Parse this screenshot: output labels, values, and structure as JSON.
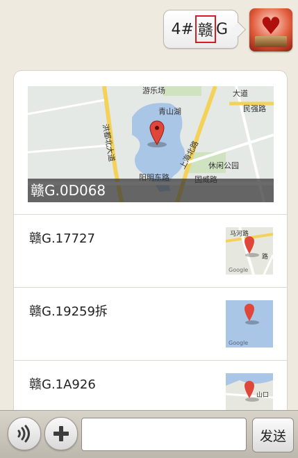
{
  "chat": {
    "message_prefix": "4#",
    "message_highlight": "赣",
    "message_suffix": "G"
  },
  "map_card": {
    "hero": {
      "caption": "赣G.0D068",
      "map_labels": [
        "游乐场",
        "青山湖",
        "大道",
        "民强路",
        "洪都北大道",
        "上海北路",
        "休闲公园",
        "阳明东路",
        "国威路"
      ]
    },
    "items": [
      {
        "label": "赣G.17727",
        "thumb_labels": [
          "马河路",
          "路",
          "Google"
        ]
      },
      {
        "label": "赣G.19259拆",
        "thumb_labels": [
          "Google"
        ]
      },
      {
        "label": "赣G.1A926",
        "thumb_labels": [
          "山口"
        ]
      }
    ]
  },
  "toolbar": {
    "send_label": "发送",
    "input_value": ""
  },
  "colors": {
    "background": "#efeadf",
    "highlight_border": "#d51d22",
    "caption_bg": "#323232"
  }
}
